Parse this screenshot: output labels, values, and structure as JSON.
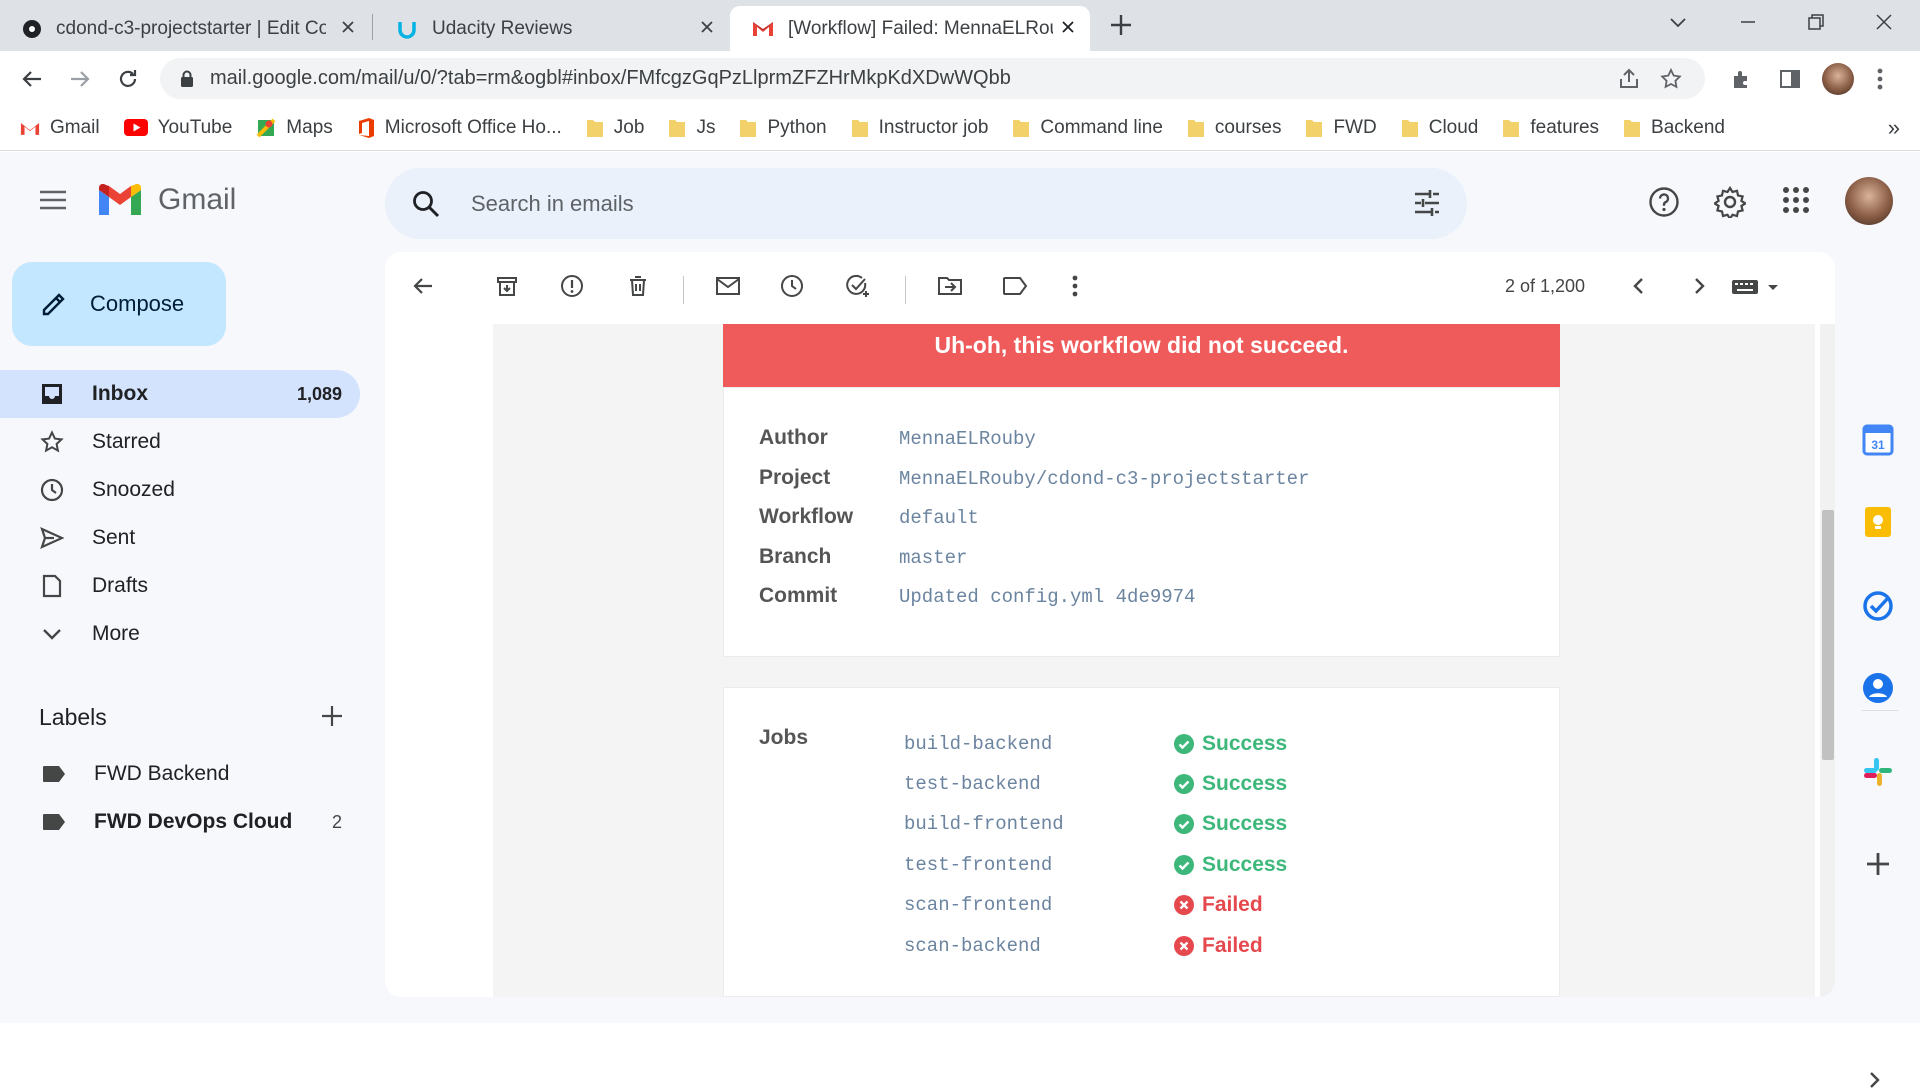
{
  "browser": {
    "tabs": [
      {
        "title": "cdond-c3-projectstarter | Edit Co",
        "icon": "circleci-icon"
      },
      {
        "title": "Udacity Reviews",
        "icon": "udacity-icon"
      },
      {
        "title": "[Workflow] Failed: MennaELRouby",
        "icon": "gmail-icon"
      }
    ],
    "url": "mail.google.com/mail/u/0/?tab=rm&ogbl#inbox/FMfcgzGqPzLlprmZFZHrMkpKdXDwWQbb",
    "bookmarks": [
      "Gmail",
      "YouTube",
      "Maps",
      "Microsoft Office Ho...",
      "Job",
      "Js",
      "Python",
      "Instructor job",
      "Command line",
      "courses",
      "FWD",
      "Cloud",
      "features",
      "Backend"
    ],
    "bookmarks_more": "»"
  },
  "gmail": {
    "wordmark": "Gmail",
    "search_placeholder": "Search in emails",
    "compose_label": "Compose",
    "nav": [
      {
        "label": "Inbox",
        "count": "1,089",
        "icon": "inbox-icon"
      },
      {
        "label": "Starred",
        "count": "",
        "icon": "star-icon"
      },
      {
        "label": "Snoozed",
        "count": "",
        "icon": "clock-icon"
      },
      {
        "label": "Sent",
        "count": "",
        "icon": "send-icon"
      },
      {
        "label": "Drafts",
        "count": "",
        "icon": "draft-icon"
      },
      {
        "label": "More",
        "count": "",
        "icon": "chevron-down-icon"
      }
    ],
    "labels_title": "Labels",
    "labels": [
      {
        "name": "FWD Backend",
        "count": ""
      },
      {
        "name": "FWD DevOps Cloud",
        "count": "2"
      }
    ],
    "pager": "2 of 1,200"
  },
  "email": {
    "banner": "Uh-oh, this workflow did not succeed.",
    "details": [
      {
        "key": "Author",
        "value": "MennaELRouby"
      },
      {
        "key": "Project",
        "value": "MennaELRouby/cdond-c3-projectstarter"
      },
      {
        "key": "Workflow",
        "value": "default"
      },
      {
        "key": "Branch",
        "value": "master"
      },
      {
        "key": "Commit",
        "value": "Updated config.yml 4de9974"
      }
    ],
    "jobs_label": "Jobs",
    "jobs": [
      {
        "name": "build-backend",
        "status": "Success"
      },
      {
        "name": "test-backend",
        "status": "Success"
      },
      {
        "name": "build-frontend",
        "status": "Success"
      },
      {
        "name": "test-frontend",
        "status": "Success"
      },
      {
        "name": "scan-frontend",
        "status": "Failed"
      },
      {
        "name": "scan-backend",
        "status": "Failed"
      }
    ]
  },
  "colors": {
    "banner": "#ef5b5b",
    "success": "#3db87a",
    "failed": "#e5484d",
    "inbox_active": "#d3e3fd",
    "compose": "#c2e7ff"
  }
}
